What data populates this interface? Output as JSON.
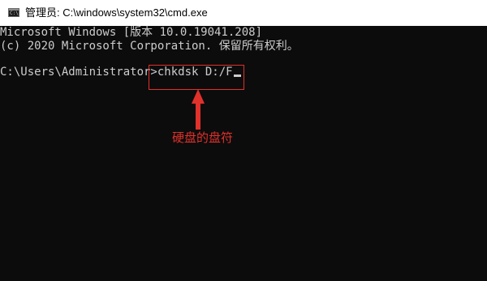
{
  "window": {
    "title": "管理员: C:\\windows\\system32\\cmd.exe",
    "icon": "cmd-app-icon",
    "icon_glyph": "C:\\"
  },
  "console": {
    "lines": [
      "Microsoft Windows [版本 10.0.19041.208]",
      "(c) 2020 Microsoft Corporation. 保留所有权利。",
      "",
      "C:\\Users\\Administrator>"
    ],
    "command": "chkdsk D:/F"
  },
  "annotation": {
    "label": "硬盘的盘符",
    "color": "#e0312b"
  }
}
